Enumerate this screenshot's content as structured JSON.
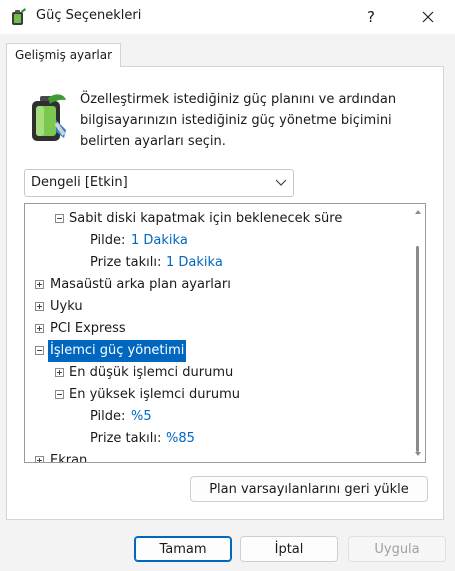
{
  "window": {
    "title": "Güç Seçenekleri",
    "help_label": "?",
    "close_icon": "close-icon",
    "app_icon": "power-options-icon"
  },
  "tabs": [
    {
      "label": "Gelişmiş ayarlar"
    }
  ],
  "description": "Özelleştirmek istediğiniz güç planını ve ardından bilgisayarınızın istediğiniz güç yönetme biçimini belirten ayarları seçin.",
  "plan_select": {
    "selected": "Dengeli [Etkin]"
  },
  "tree": {
    "rows": [
      {
        "label": "Sabit diski kapatmak için beklenecek süre",
        "expander": "minus"
      },
      {
        "label": "Pilde:",
        "value": "1 Dakika"
      },
      {
        "label": "Prize takılı:",
        "value": "1 Dakika"
      },
      {
        "label": "Masaüstü arka plan ayarları",
        "expander": "plus"
      },
      {
        "label": "Uyku",
        "expander": "plus"
      },
      {
        "label": "PCI Express",
        "expander": "plus"
      },
      {
        "label": "İşlemci güç yönetimi",
        "expander": "minus",
        "selected": true
      },
      {
        "label": "En düşük işlemci durumu",
        "expander": "plus"
      },
      {
        "label": "En yüksek işlemci durumu",
        "expander": "minus"
      },
      {
        "label": "Pilde:",
        "value": "%5"
      },
      {
        "label": "Prize takılı:",
        "value": "%85"
      },
      {
        "label": "Ekran",
        "expander": "plus"
      }
    ]
  },
  "buttons": {
    "restore_defaults": "Plan varsayılanlarını geri yükle",
    "ok": "Tamam",
    "cancel": "İptal",
    "apply": "Uygula"
  },
  "colors": {
    "accent": "#0067c0",
    "value_text": "#0067c0"
  }
}
